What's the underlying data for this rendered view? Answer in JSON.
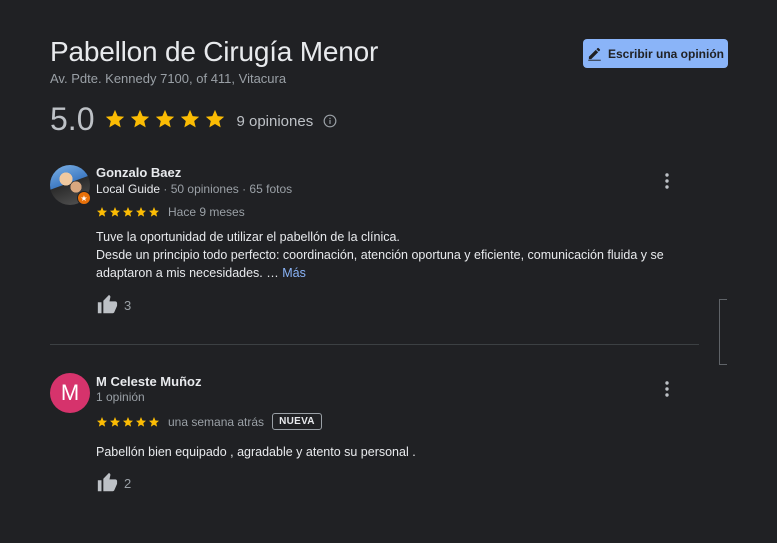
{
  "place": {
    "name": "Pabellon de Cirugía Menor",
    "address": "Av. Pdte. Kennedy 7100, of 411, Vitacura",
    "rating": "5.0",
    "review_count_label": "9 opiniones"
  },
  "actions": {
    "write_review_label": "Escribir una opinión"
  },
  "colors": {
    "accent": "#8ab4f8",
    "star": "#fbbc04",
    "background": "#202124"
  },
  "reviews": [
    {
      "author": "Gonzalo Baez",
      "local_guide": "Local Guide",
      "stats": " · 50 opiniones · 65 fotos",
      "date": "Hace 9 meses",
      "text_line1": "Tuve la oportunidad de utilizar el pabellón de la clínica.",
      "text_line2": "Desde un principio todo perfecto: coordinación, atención oportuna y eficiente, comunicación fluida y se adaptaron a mis necesidades. …",
      "more_label": "Más",
      "likes": "3",
      "avatar_icon": "profile-photo"
    },
    {
      "author": "M Celeste Muñoz",
      "avatar_letter": "M",
      "stats": "1 opinión",
      "date": "una semana atrás",
      "badge": "NUEVA",
      "text_line1": "Pabellón bien equipado , agradable y atento su personal .",
      "likes": "2"
    }
  ]
}
